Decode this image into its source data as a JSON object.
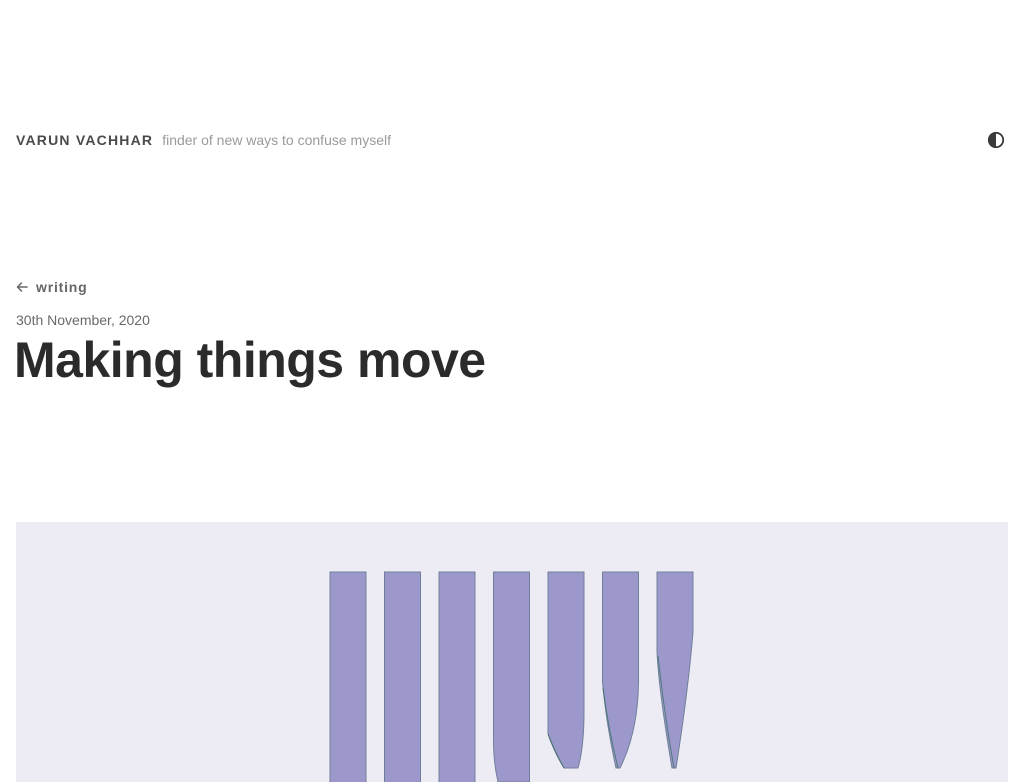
{
  "header": {
    "site_name": "VARUN VACHHAR",
    "tagline": "finder of new ways to confuse myself",
    "theme_toggle_icon": "contrast-icon"
  },
  "nav": {
    "back_label": "writing",
    "back_icon": "arrow-left-icon"
  },
  "post": {
    "date": "30th November, 2020",
    "title": "Making things move"
  },
  "figure": {
    "bar_fill": "#9d98cb",
    "bar_stroke": "#6f7f99",
    "background": "#edecf5",
    "bar_count": 7
  }
}
